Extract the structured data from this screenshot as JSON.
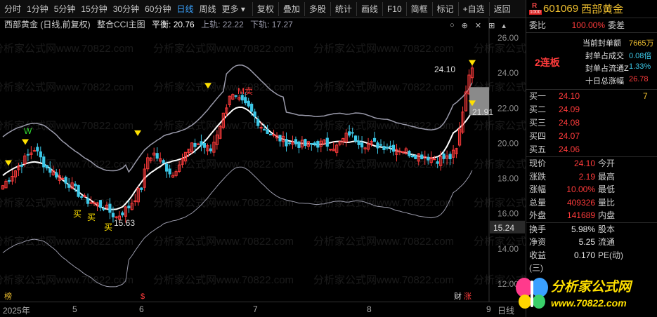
{
  "toolbar": {
    "items": [
      "分时",
      "1分钟",
      "5分钟",
      "15分钟",
      "30分钟",
      "60分钟",
      "日线",
      "周线",
      "更多 ▾"
    ],
    "active_index": 6,
    "tools": [
      "复权",
      "叠加",
      "多股",
      "统计",
      "画线",
      "F10",
      "简框",
      "标记",
      "+自选",
      "返回"
    ]
  },
  "chart_header": {
    "name": "西部黄金 (日线,前复权)",
    "indicator": "整合CCI主图",
    "mid_label": "平衡: 20.76",
    "upper_label": "上轨: 22.22",
    "lower_label": "下轨: 17.27"
  },
  "header_icons": [
    "○",
    "⊕",
    "✕",
    "⊞",
    "▴"
  ],
  "chart_data": {
    "type": "candlestick",
    "y_axis_ticks": [
      "26.00",
      "24.00",
      "22.00",
      "20.00",
      "18.00",
      "16.00",
      "14.00",
      "12.00"
    ],
    "y_range": [
      11.4,
      26.8
    ],
    "last_price_tag": "15.24",
    "annotations": [
      "W",
      "买",
      "买",
      "买",
      "15.63",
      "M卖",
      "24.10",
      "21.91"
    ],
    "x_labels": [
      "2025年",
      "5",
      "6",
      "7",
      "8",
      "9"
    ],
    "bottom_marks": [
      "榜",
      "$",
      "财",
      "涨"
    ],
    "right_cut_label": "日线"
  },
  "watermark_text": "分析家公式网www.70822.com",
  "panel": {
    "badge_r": "R",
    "badge_num": "1000",
    "code": "601069",
    "name": "西部黄金",
    "weibi_label": "委比",
    "weibi_value": "100.00%",
    "weicha_label": "委差",
    "lianban": "2连板",
    "seal": [
      {
        "label": "当前封单额",
        "value": "7665万"
      },
      {
        "label": "封单占成交",
        "value": "0.08倍"
      },
      {
        "label": "封单占流通Z",
        "value": "1.33%"
      },
      {
        "label": "十日总涨幅",
        "value": "26.78"
      }
    ],
    "book": [
      {
        "label": "买一",
        "price": "24.10",
        "vol": "7"
      },
      {
        "label": "买二",
        "price": "24.09",
        "vol": ""
      },
      {
        "label": "买三",
        "price": "24.08",
        "vol": ""
      },
      {
        "label": "买四",
        "price": "24.07",
        "vol": ""
      },
      {
        "label": "买五",
        "price": "24.06",
        "vol": ""
      }
    ],
    "quote": [
      {
        "k": "现价",
        "v": "24.10",
        "k2": "今开"
      },
      {
        "k": "涨跌",
        "v": "2.19",
        "k2": "最高"
      },
      {
        "k": "涨幅",
        "v": "10.00%",
        "k2": "最低"
      },
      {
        "k": "总量",
        "v": "409326",
        "k2": "量比"
      },
      {
        "k": "外盘",
        "v": "141689",
        "k2": "内盘"
      }
    ],
    "quote2": [
      {
        "k": "换手",
        "v": "5.98%",
        "k2": "股本"
      },
      {
        "k": "净资",
        "v": "5.25",
        "k2": "流通"
      },
      {
        "k": "收益(三)",
        "v": "0.170",
        "k2": "PE(动)"
      }
    ]
  },
  "logo": {
    "line1": "分析家公式网",
    "line2": "www.70822.com"
  },
  "colors": {
    "up": "#ff3b3b",
    "down": "#3cc8e8",
    "mid": "#ffffff",
    "band": "#9a9aaa",
    "accent": "#f0c030"
  }
}
